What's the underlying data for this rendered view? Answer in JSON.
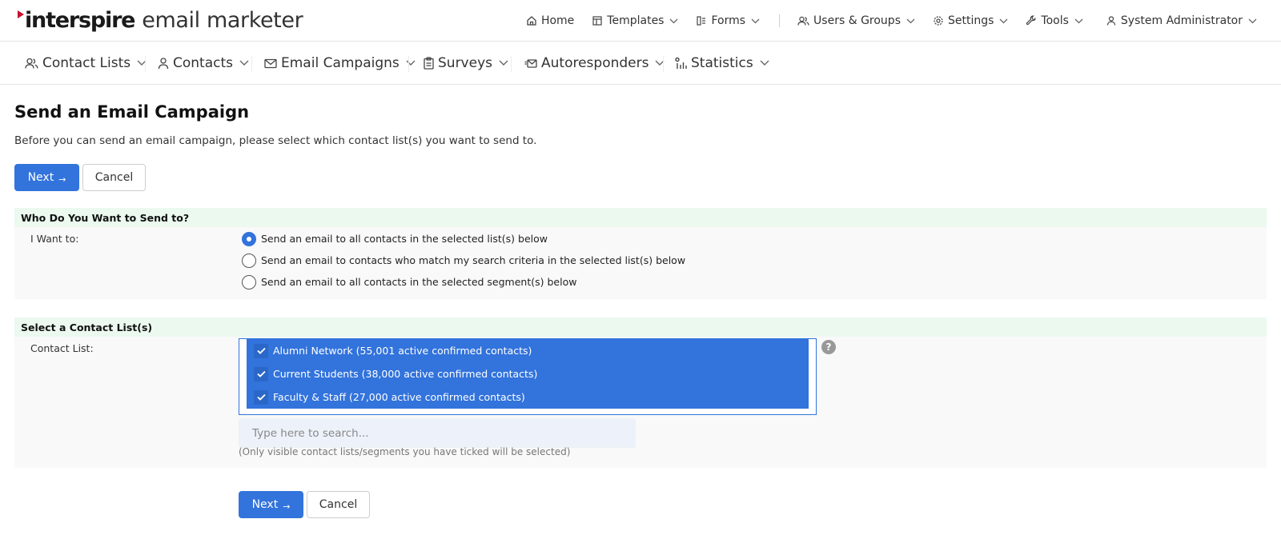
{
  "brand": {
    "name": "interspire",
    "product": "email marketer",
    "accent_color": "#c8102e"
  },
  "topnav": {
    "home": "Home",
    "templates": "Templates",
    "forms": "Forms",
    "users_groups": "Users & Groups",
    "settings": "Settings",
    "tools": "Tools",
    "user": "System Administrator"
  },
  "mainnav": {
    "contact_lists": "Contact Lists",
    "contacts": "Contacts",
    "email_campaigns": "Email Campaigns",
    "surveys": "Surveys",
    "autoresponders": "Autoresponders",
    "statistics": "Statistics"
  },
  "page": {
    "title": "Send an Email Campaign",
    "description": "Before you can send an email campaign, please select which contact list(s) you want to send to."
  },
  "buttons": {
    "next": "Next",
    "next_arrow": "→",
    "cancel": "Cancel"
  },
  "send_to": {
    "heading": "Who Do You Want to Send to?",
    "label": "I Want to:",
    "options": [
      {
        "label": "Send an email to all contacts in the selected list(s) below",
        "checked": true
      },
      {
        "label": "Send an email to contacts who match my search criteria in the selected list(s) below",
        "checked": false
      },
      {
        "label": "Send an email to all contacts in the selected segment(s) below",
        "checked": false
      }
    ]
  },
  "contact_list": {
    "heading": "Select a Contact List(s)",
    "label": "Contact List:",
    "items": [
      {
        "label": "Alumni Network (55,001 active confirmed contacts)",
        "checked": true
      },
      {
        "label": "Current Students (38,000 active confirmed contacts)",
        "checked": true
      },
      {
        "label": "Faculty & Staff (27,000 active confirmed contacts)",
        "checked": true
      }
    ],
    "help": "?",
    "search_placeholder": "Type here to search...",
    "hint": "(Only visible contact lists/segments you have ticked will be selected)"
  },
  "colors": {
    "primary": "#3273dc",
    "section_head_bg": "#ebf9ef",
    "section_body_bg": "#f9f9f9"
  },
  "icons": {
    "home": "home-icon",
    "templates": "templates-icon",
    "forms": "forms-icon",
    "users": "users-icon",
    "settings": "gear-icon",
    "tools": "wrench-icon",
    "user": "user-icon",
    "contact_lists": "contact-lists-icon",
    "contacts": "contact-icon",
    "email": "envelope-icon",
    "surveys": "clipboard-icon",
    "autoresponders": "autoresponder-icon",
    "statistics": "statistics-icon",
    "chevron": "chevron-down-icon",
    "check": "check-icon",
    "help": "help-icon"
  }
}
